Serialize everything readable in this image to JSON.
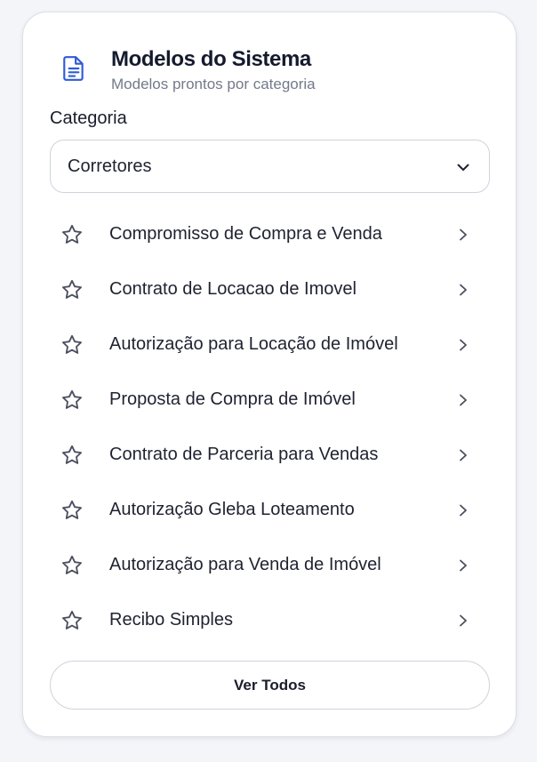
{
  "header": {
    "title": "Modelos do Sistema",
    "subtitle": "Modelos prontos por categoria",
    "icon": "document-icon"
  },
  "category": {
    "label": "Categoria",
    "selected": "Corretores"
  },
  "templates": [
    {
      "label": "Compromisso de Compra e Venda"
    },
    {
      "label": "Contrato de Locacao de Imovel"
    },
    {
      "label": "Autorização para Locação de Imóvel"
    },
    {
      "label": "Proposta de Compra de Imóvel"
    },
    {
      "label": "Contrato de Parceria para Vendas"
    },
    {
      "label": "Autorização Gleba Loteamento"
    },
    {
      "label": "Autorização para Venda de Imóvel"
    },
    {
      "label": "Recibo Simples"
    }
  ],
  "footer": {
    "view_all_label": "Ver Todos"
  },
  "colors": {
    "accent": "#2f5bd6",
    "text": "#1f2230",
    "muted": "#737a8a",
    "border": "#cfd3db"
  }
}
